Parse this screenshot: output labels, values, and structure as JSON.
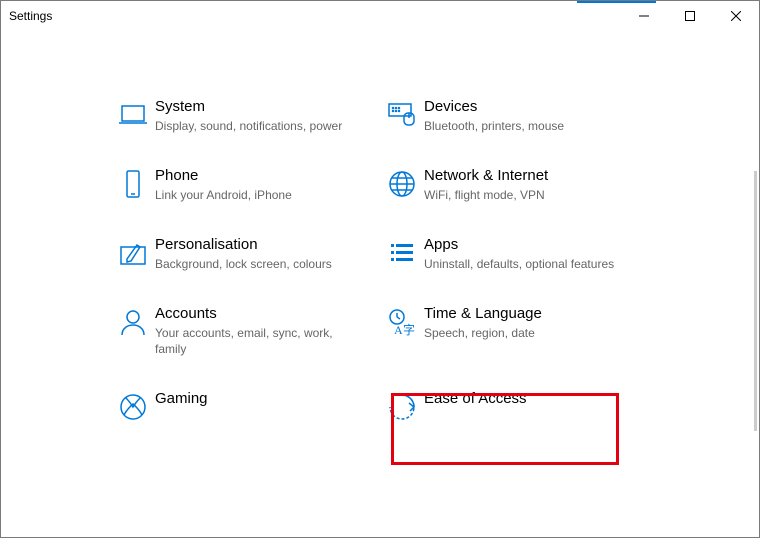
{
  "window": {
    "title": "Settings"
  },
  "accent_color": "#0078d7",
  "categories": [
    {
      "id": "system",
      "icon": "laptop-icon",
      "title": "System",
      "desc": "Display, sound, notifications, power"
    },
    {
      "id": "devices",
      "icon": "devices-icon",
      "title": "Devices",
      "desc": "Bluetooth, printers, mouse"
    },
    {
      "id": "phone",
      "icon": "phone-icon",
      "title": "Phone",
      "desc": "Link your Android, iPhone"
    },
    {
      "id": "network",
      "icon": "globe-icon",
      "title": "Network & Internet",
      "desc": "WiFi, flight mode, VPN"
    },
    {
      "id": "personalisation",
      "icon": "brush-icon",
      "title": "Personalisation",
      "desc": "Background, lock screen, colours"
    },
    {
      "id": "apps",
      "icon": "apps-icon",
      "title": "Apps",
      "desc": "Uninstall, defaults, optional features"
    },
    {
      "id": "accounts",
      "icon": "person-icon",
      "title": "Accounts",
      "desc": "Your accounts, email, sync, work, family"
    },
    {
      "id": "time_language",
      "icon": "time-language-icon",
      "title": "Time & Language",
      "desc": "Speech, region, date",
      "highlighted": true
    },
    {
      "id": "gaming",
      "icon": "xbox-icon",
      "title": "Gaming",
      "desc": ""
    },
    {
      "id": "ease_of_access",
      "icon": "ease-of-access-icon",
      "title": "Ease of Access",
      "desc": ""
    }
  ]
}
